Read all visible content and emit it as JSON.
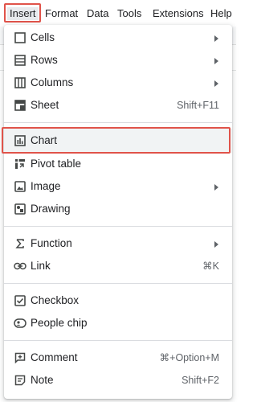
{
  "menubar": {
    "items": [
      {
        "label": "Insert",
        "active": true
      },
      {
        "label": "Format"
      },
      {
        "label": "Data"
      },
      {
        "label": "Tools"
      },
      {
        "label": "Extensions"
      },
      {
        "label": "Help"
      }
    ]
  },
  "insert_menu": {
    "items": [
      {
        "label": "Cells",
        "icon": "square-outline-icon",
        "submenu": true
      },
      {
        "label": "Rows",
        "icon": "rows-icon",
        "submenu": true
      },
      {
        "label": "Columns",
        "icon": "columns-icon",
        "submenu": true
      },
      {
        "label": "Sheet",
        "icon": "sheet-icon",
        "shortcut": "Shift+F11"
      },
      {
        "label": "Chart",
        "icon": "bar-chart-icon",
        "highlighted": true
      },
      {
        "label": "Pivot table",
        "icon": "pivot-table-icon"
      },
      {
        "label": "Image",
        "icon": "image-icon",
        "submenu": true
      },
      {
        "label": "Drawing",
        "icon": "drawing-icon"
      },
      {
        "label": "Function",
        "icon": "sigma-icon",
        "submenu": true
      },
      {
        "label": "Link",
        "icon": "link-icon",
        "shortcut": "⌘K"
      },
      {
        "label": "Checkbox",
        "icon": "checkbox-icon"
      },
      {
        "label": "People chip",
        "icon": "person-chip-icon"
      },
      {
        "label": "Comment",
        "icon": "add-comment-icon",
        "shortcut": "⌘+Option+M"
      },
      {
        "label": "Note",
        "icon": "note-icon",
        "shortcut": "Shift+F2"
      }
    ]
  },
  "colors": {
    "highlight_border": "#e0534a",
    "hover_bg": "#f1f3f4",
    "icon": "#444746"
  }
}
